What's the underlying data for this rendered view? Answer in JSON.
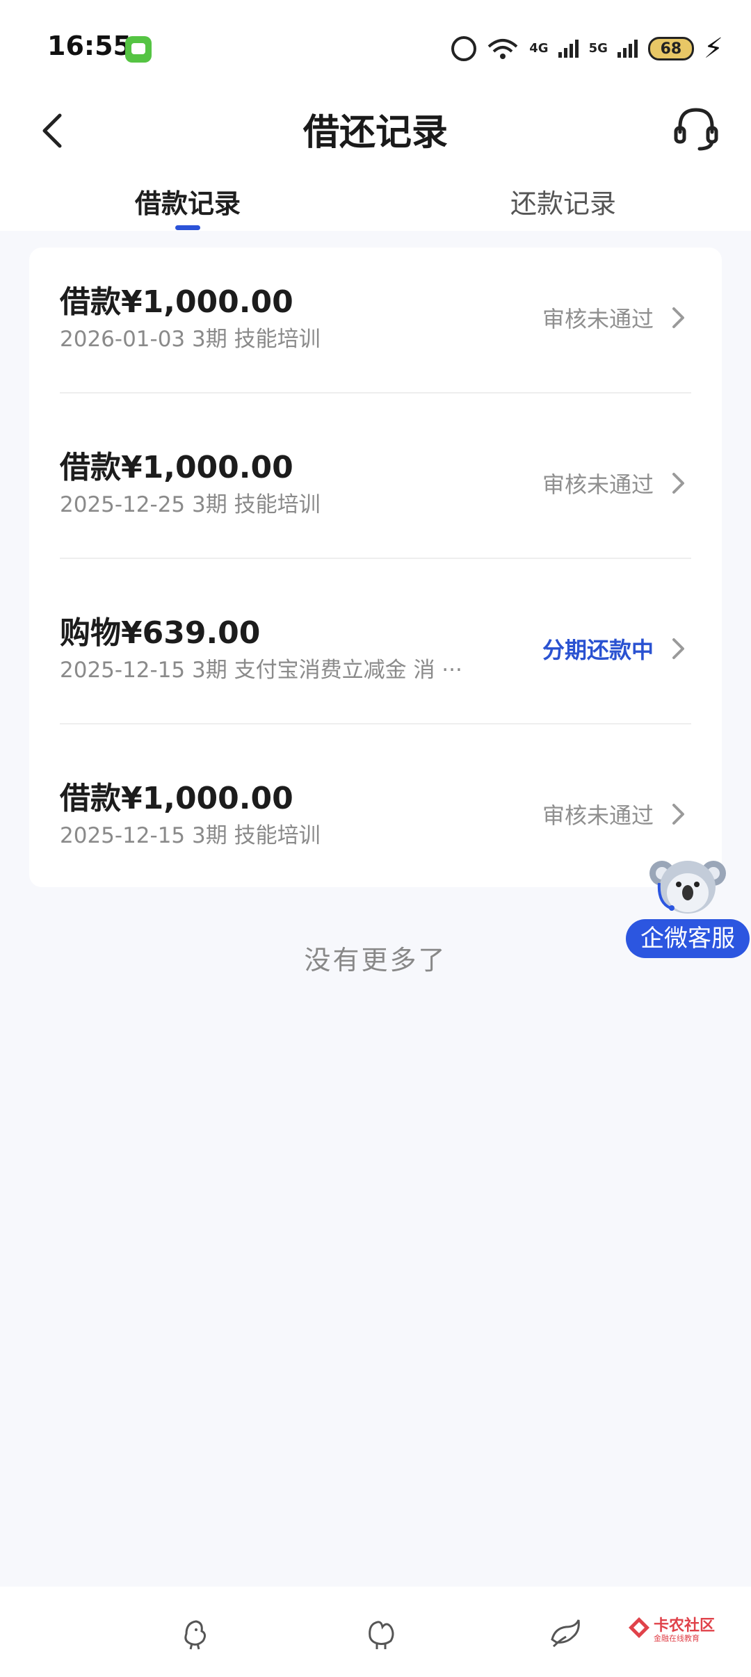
{
  "status_bar": {
    "time": "16:55",
    "signal_1": "4G",
    "signal_2": "5G",
    "battery": "68"
  },
  "nav": {
    "title": "借还记录"
  },
  "tabs": [
    {
      "label": "借款记录",
      "active": true
    },
    {
      "label": "还款记录",
      "active": false
    }
  ],
  "records": [
    {
      "amount": "借款¥1,000.00",
      "meta": "2026-01-03 3期  技能培训",
      "status": "审核未通过",
      "status_color": "#8f8f8f"
    },
    {
      "amount": "借款¥1,000.00",
      "meta": "2025-12-25 3期  技能培训",
      "status": "审核未通过",
      "status_color": "#8f8f8f"
    },
    {
      "amount": "购物¥639.00",
      "meta": "2025-12-15 3期  支付宝消费立减金 消 ···",
      "status": "分期还款中",
      "status_color": "#2a52d1"
    },
    {
      "amount": "借款¥1,000.00",
      "meta": "2025-12-15 3期  技能培训",
      "status": "审核未通过",
      "status_color": "#8f8f8f"
    }
  ],
  "footer": {
    "no_more": "没有更多了"
  },
  "float_service": {
    "label": "企微客服"
  },
  "watermark": {
    "title": "卡农社区",
    "subtitle": "金融在线教育"
  },
  "icons": {
    "back": "chevron-left-icon",
    "service": "headset-icon",
    "row": "chevron-right-icon"
  },
  "colors": {
    "accent": "#2c53d8",
    "background": "#f7f8fc"
  }
}
